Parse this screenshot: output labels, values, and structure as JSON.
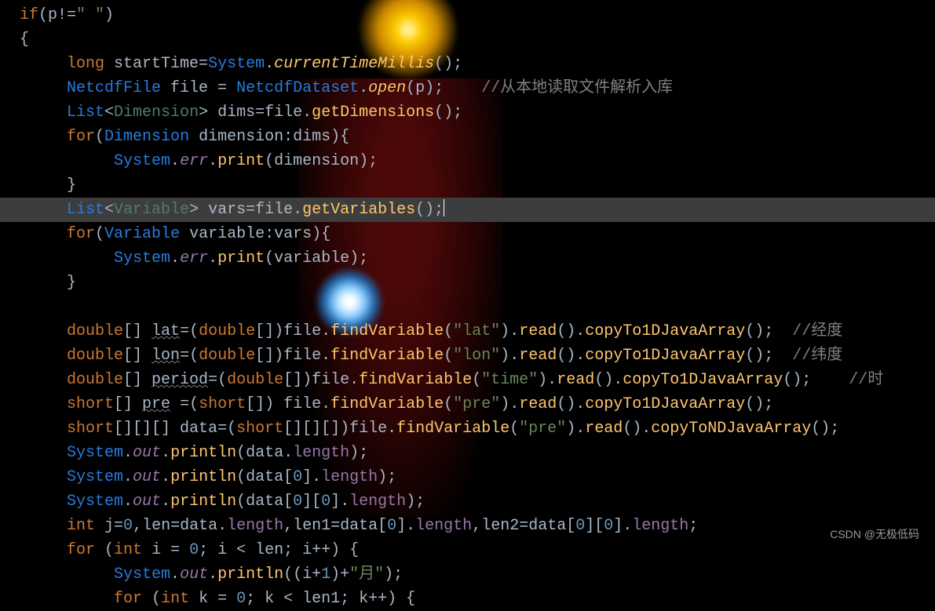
{
  "code": {
    "l1": {
      "a": "if",
      "b": "(p!=",
      "c": "\" \"",
      "d": ")"
    },
    "l2": "{",
    "l3": {
      "a": "long ",
      "b": "startTime=",
      "c": "System",
      "d": ".",
      "e": "currentTimeMillis",
      "f": "();"
    },
    "l4": {
      "a": "NetcdfFile ",
      "b": "file = ",
      "c": "NetcdfDataset",
      "d": ".",
      "e": "open",
      "f": "(p);",
      "g": "//从本地读取文件解析入库"
    },
    "l5": {
      "a": "List",
      "b": "<",
      "c": "Dimension",
      "d": "> ",
      "e": "dims=file.",
      "f": "getDimensions",
      "g": "();"
    },
    "l6": {
      "a": "for",
      "b": "(",
      "c": "Dimension ",
      "d": "dimension:dims){"
    },
    "l7": {
      "a": "System",
      "b": ".",
      "c": "err",
      "d": ".",
      "e": "print",
      "f": "(dimension);"
    },
    "l8": "}",
    "l9": {
      "a": "List",
      "b": "<",
      "c": "Variable",
      "d": "> ",
      "e": "vars=file.",
      "f": "getVariables",
      "g": "();"
    },
    "l10": {
      "a": "for",
      "b": "(",
      "c": "Variable ",
      "d": "variable:vars){"
    },
    "l11": {
      "a": "System",
      "b": ".",
      "c": "err",
      "d": ".",
      "e": "print",
      "f": "(variable);"
    },
    "l12": "}",
    "l14": {
      "a": "double",
      "b": "[] ",
      "c": "lat",
      "d": "=(",
      "e": "double",
      "f": "[])file.",
      "g": "findVariable",
      "h": "(",
      "i": "\"lat\"",
      "j": ").",
      "k": "read",
      "l": "().",
      "m": "copyTo1DJavaArray",
      "n": "();  ",
      "o": "//经度"
    },
    "l15": {
      "a": "double",
      "b": "[] ",
      "c": "lon",
      "d": "=(",
      "e": "double",
      "f": "[])file.",
      "g": "findVariable",
      "h": "(",
      "i": "\"lon\"",
      "j": ").",
      "k": "read",
      "l": "().",
      "m": "copyTo1DJavaArray",
      "n": "();  ",
      "o": "//纬度"
    },
    "l16": {
      "a": "double",
      "b": "[] ",
      "c": "period",
      "d": "=(",
      "e": "double",
      "f": "[])file.",
      "g": "findVariable",
      "h": "(",
      "i": "\"time\"",
      "j": ").",
      "k": "read",
      "l": "().",
      "m": "copyTo1DJavaArray",
      "n": "();    ",
      "o": "//时"
    },
    "l17": {
      "a": "short",
      "b": "[] ",
      "c": "pre",
      "d": " =(",
      "e": "short",
      "f": "[]) file.",
      "g": "findVariable",
      "h": "(",
      "i": "\"pre\"",
      "j": ").",
      "k": "read",
      "l": "().",
      "m": "copyTo1DJavaArray",
      "n": "();"
    },
    "l18": {
      "a": "short",
      "b": "[][][] ",
      "c": "data",
      "d": "=(",
      "e": "short",
      "f": "[][][])file.",
      "g": "findVariable",
      "h": "(",
      "i": "\"pre\"",
      "j": ").",
      "k": "read",
      "l": "().",
      "m": "copyToNDJavaArray",
      "n": "();"
    },
    "l19": {
      "a": "System",
      "b": ".",
      "c": "out",
      "d": ".",
      "e": "println",
      "f": "(data.",
      "g": "length",
      "h": ");"
    },
    "l20": {
      "a": "System",
      "b": ".",
      "c": "out",
      "d": ".",
      "e": "println",
      "f": "(data[",
      "g": "0",
      "h": "].",
      "i": "length",
      "j": ");"
    },
    "l21": {
      "a": "System",
      "b": ".",
      "c": "out",
      "d": ".",
      "e": "println",
      "f": "(data[",
      "g": "0",
      "h": "][",
      "i": "0",
      "j": "].",
      "k": "length",
      "l": ");"
    },
    "l22": {
      "a": "int ",
      "b": "j=",
      "c": "0",
      "d": ",len=data.",
      "e": "length",
      "f": ",len1=data[",
      "g": "0",
      "h": "].",
      "i": "length",
      "j": ",len2=data[",
      "k": "0",
      "l": "][",
      "m": "0",
      "n": "].",
      "o": "length",
      "p": ";"
    },
    "l23": {
      "a": "for ",
      "b": "(",
      "c": "int ",
      "d": "i = ",
      "e": "0",
      "f": "; i < len; i++) {"
    },
    "l24": {
      "a": "System",
      "b": ".",
      "c": "out",
      "d": ".",
      "e": "println",
      "f": "((i+",
      "g": "1",
      "h": ")+",
      "i": "\"月\"",
      "j": ");"
    },
    "l25": {
      "a": "for ",
      "b": "(",
      "c": "int ",
      "d": "k = ",
      "e": "0",
      "f": "; k < len1; k++) {"
    }
  },
  "watermark": "CSDN @无极低码"
}
